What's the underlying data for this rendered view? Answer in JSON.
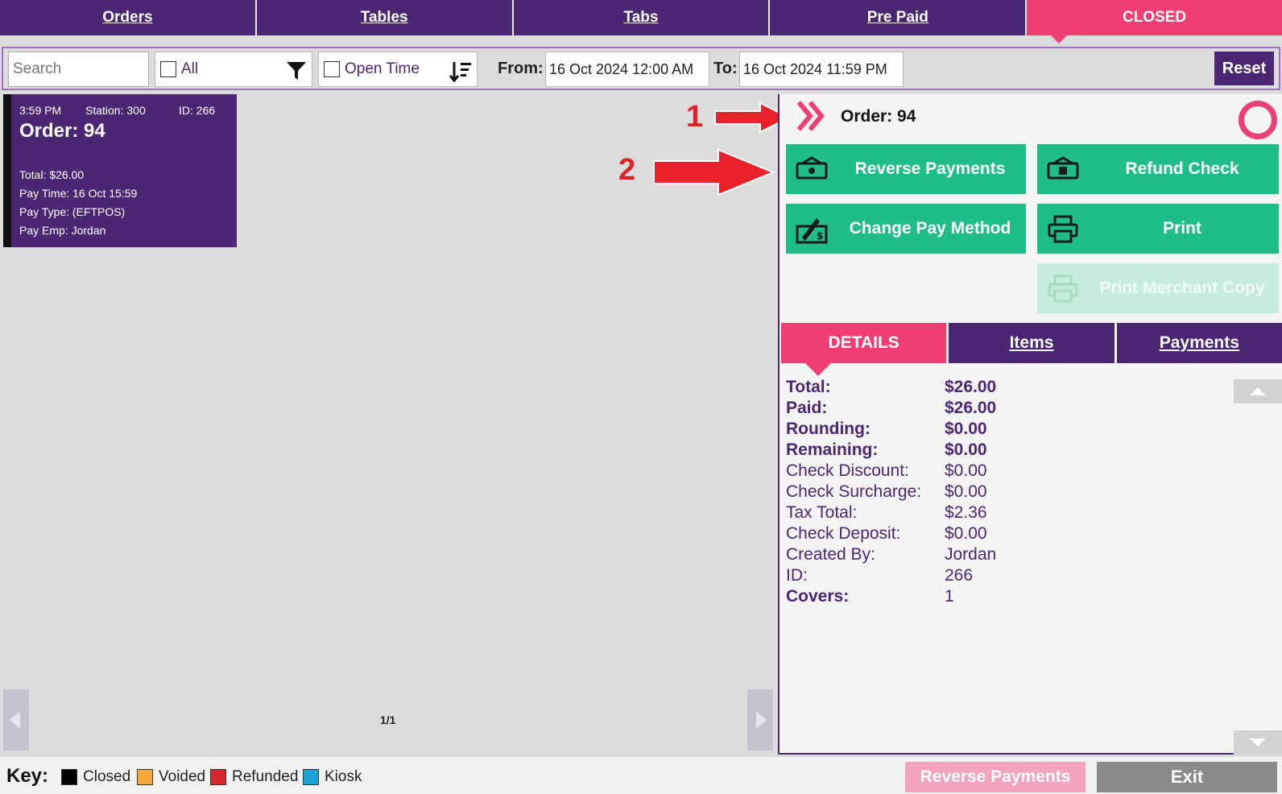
{
  "top_tabs": [
    "Orders",
    "Tables",
    "Tabs",
    "Pre Paid",
    "CLOSED"
  ],
  "filter": {
    "search_placeholder": "Search",
    "all_label": "All",
    "open_time_label": "Open Time",
    "from_label": "From:",
    "from_value": "16 Oct 2024 12:00 AM",
    "to_label": "To:",
    "to_value": "16 Oct 2024 11:59 PM",
    "reset_label": "Reset"
  },
  "card": {
    "time": "3:59 PM",
    "station": "Station: 300",
    "id": "ID: 266",
    "order": "Order: 94",
    "total": "Total: $26.00",
    "pay_time": "Pay Time: 16 Oct 15:59",
    "pay_type": "Pay Type: (EFTPOS)",
    "pay_emp": "Pay Emp: Jordan"
  },
  "pager": {
    "count": "1/1"
  },
  "panel": {
    "order_title": "Order: 94",
    "actions": {
      "reverse_payments": "Reverse Payments",
      "refund_check": "Refund Check",
      "change_pay_method": "Change Pay Method",
      "print": "Print",
      "print_merchant_copy": "Print Merchant Copy"
    },
    "detail_tabs": [
      "DETAILS",
      "Items",
      "Payments"
    ],
    "details": [
      {
        "k": "Total:",
        "v": "$26.00"
      },
      {
        "k": "Paid:",
        "v": "$26.00"
      },
      {
        "k": "Rounding:",
        "v": "$0.00"
      },
      {
        "k": "Remaining:",
        "v": "$0.00"
      },
      {
        "k": "Check Discount:",
        "v": "$0.00"
      },
      {
        "k": "Check Surcharge:",
        "v": "$0.00"
      },
      {
        "k": "Tax Total:",
        "v": "$2.36"
      },
      {
        "k": "Check Deposit:",
        "v": "$0.00"
      },
      {
        "k": "Created By:",
        "v": "Jordan"
      },
      {
        "k": "ID:",
        "v": "266"
      },
      {
        "k": "Covers:",
        "v": "1"
      }
    ]
  },
  "annotations": {
    "one": "1",
    "two": "2"
  },
  "bottom": {
    "key_label": "Key:",
    "keys": [
      {
        "label": "Closed",
        "color": "#000000"
      },
      {
        "label": "Voided",
        "color": "#f7a93b"
      },
      {
        "label": "Refunded",
        "color": "#d42a2f"
      },
      {
        "label": "Kiosk",
        "color": "#18a5d6"
      }
    ],
    "reverse_payments": "Reverse Payments",
    "exit": "Exit"
  },
  "colors": {
    "brand": "#4b2672",
    "accent": "#ee3e74",
    "action": "#1fbd87"
  }
}
